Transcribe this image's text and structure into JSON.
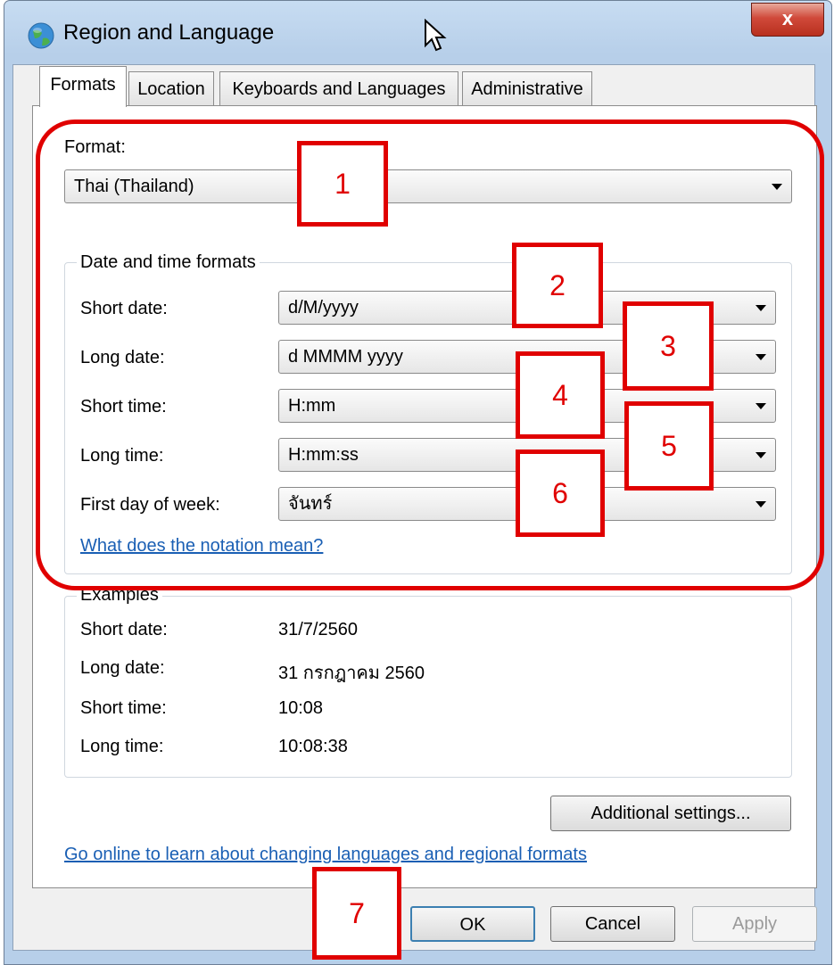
{
  "window": {
    "title": "Region and Language",
    "close_label": "x"
  },
  "tabs": [
    {
      "label": "Formats",
      "active": true
    },
    {
      "label": "Location",
      "active": false
    },
    {
      "label": "Keyboards and Languages",
      "active": false
    },
    {
      "label": "Administrative",
      "active": false
    }
  ],
  "format": {
    "label": "Format:",
    "value": "Thai (Thailand)"
  },
  "date_time": {
    "title": "Date and time formats",
    "rows": [
      {
        "label": "Short date:",
        "value": "d/M/yyyy"
      },
      {
        "label": "Long date:",
        "value": "d MMMM yyyy"
      },
      {
        "label": "Short time:",
        "value": "H:mm"
      },
      {
        "label": "Long time:",
        "value": "H:mm:ss"
      },
      {
        "label": "First day of week:",
        "value": "จันทร์"
      }
    ],
    "notation_link": "What does the notation mean?"
  },
  "examples": {
    "title": "Examples",
    "rows": [
      {
        "label": "Short date:",
        "value": "31/7/2560"
      },
      {
        "label": "Long date:",
        "value": "31 กรกฎาคม 2560"
      },
      {
        "label": "Short time:",
        "value": "10:08"
      },
      {
        "label": "Long time:",
        "value": "10:08:38"
      }
    ]
  },
  "additional_settings_label": "Additional settings...",
  "online_link": "Go online to learn about changing languages and regional formats",
  "buttons": {
    "ok": "OK",
    "cancel": "Cancel",
    "apply": "Apply"
  },
  "annotations": [
    "1",
    "2",
    "3",
    "4",
    "5",
    "6",
    "7"
  ],
  "colors": {
    "annotation": "#e00000",
    "link": "#1a5fb4",
    "titlebar": "#b7cfe9"
  }
}
